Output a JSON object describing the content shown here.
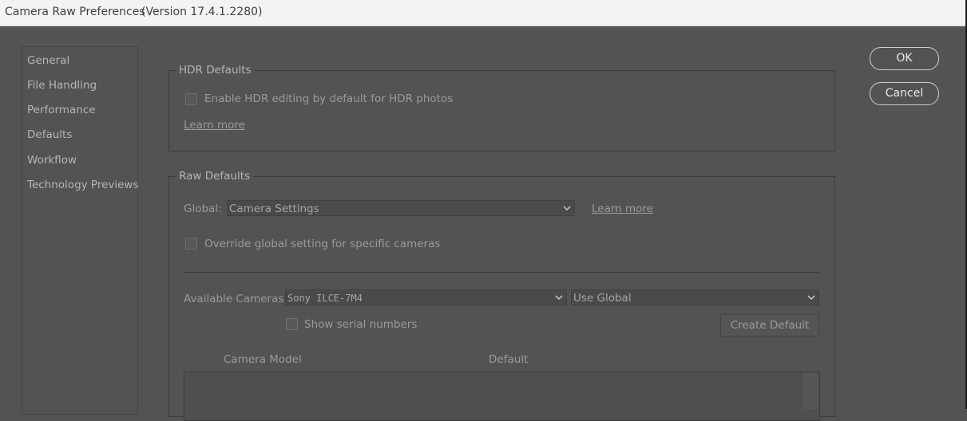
{
  "window": {
    "title": "Camera Raw Preferences",
    "version": "(Version 17.4.1.2280)"
  },
  "sidebar": {
    "items": [
      {
        "label": "General"
      },
      {
        "label": "File Handling"
      },
      {
        "label": "Performance"
      },
      {
        "label": "Defaults"
      },
      {
        "label": "Workflow"
      },
      {
        "label": "Technology Previews"
      }
    ]
  },
  "hdr": {
    "title": "HDR Defaults",
    "enable_label": "Enable HDR editing by default for HDR photos",
    "enable_checked": false,
    "learn_more": "Learn more"
  },
  "raw": {
    "title": "Raw Defaults",
    "global_label": "Global:",
    "global_value": "Camera Settings",
    "learn_more": "Learn more",
    "override_label": "Override global setting for specific cameras",
    "override_checked": false,
    "available_label": "Available Cameras:",
    "camera_value": "Sony ILCE-7M4",
    "use_value": "Use Global",
    "serial_label": "Show serial numbers",
    "serial_checked": false,
    "create_default": "Create Default",
    "columns": [
      "Camera Model",
      "Default"
    ]
  },
  "buttons": {
    "ok": "OK",
    "cancel": "Cancel"
  },
  "icons": {
    "dropdown": "chevron-down-icon"
  }
}
